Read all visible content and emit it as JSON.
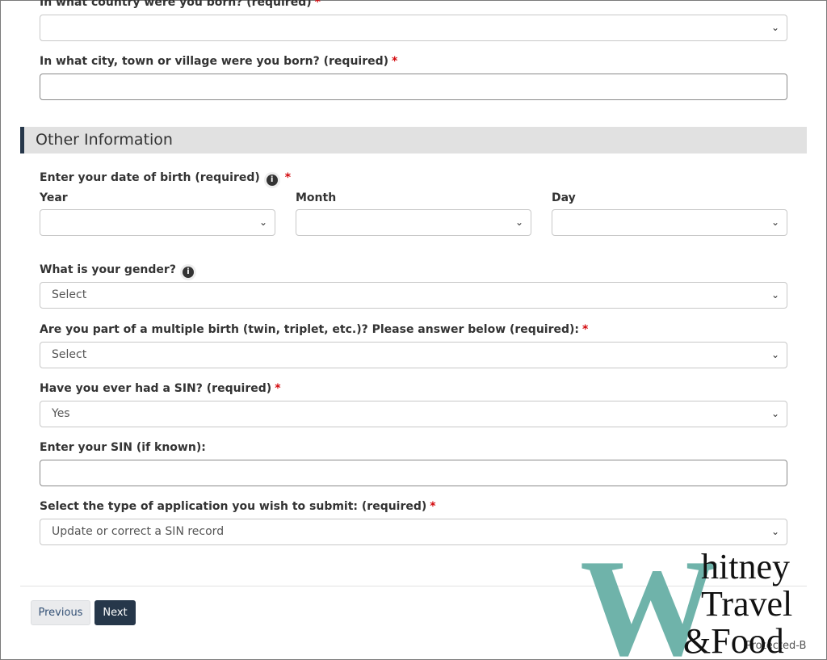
{
  "country": {
    "question": "In what country were you born? (required)",
    "required_mark": "*",
    "value": ""
  },
  "city": {
    "question": "In what city, town or village were you born? (required)",
    "required_mark": "*",
    "value": ""
  },
  "section": {
    "title": "Other Information"
  },
  "dob": {
    "question": "Enter your date of birth (required)",
    "required_mark": "*",
    "year_label": "Year",
    "month_label": "Month",
    "day_label": "Day",
    "year_value": "",
    "month_value": "",
    "day_value": ""
  },
  "gender": {
    "question": "What is your gender?",
    "value": "Select"
  },
  "multiple_birth": {
    "question": "Are you part of a multiple birth (twin, triplet, etc.)? Please answer below (required):",
    "required_mark": "*",
    "value": "Select"
  },
  "had_sin": {
    "question": "Have you ever had a SIN? (required)",
    "required_mark": "*",
    "value": "Yes"
  },
  "sin": {
    "question": "Enter your SIN (if known):",
    "value": ""
  },
  "app_type": {
    "question": "Select the type of application you wish to submit: (required)",
    "required_mark": "*",
    "value": "Update or correct a SIN record"
  },
  "buttons": {
    "previous": "Previous",
    "next": "Next"
  },
  "footer": {
    "classification": "Protected-B"
  },
  "watermark": {
    "big_letter": "W",
    "line1": "hitney",
    "line2": "Travel",
    "line3": "&Food",
    "color": "#6fb3aa"
  },
  "icons": {
    "info": "info-icon",
    "dropdown": "chevron-down-icon"
  },
  "colors": {
    "required": "#d3080c",
    "section_bar": "#26374a",
    "section_bg": "#e1e1e1",
    "next_button": "#26374a"
  }
}
